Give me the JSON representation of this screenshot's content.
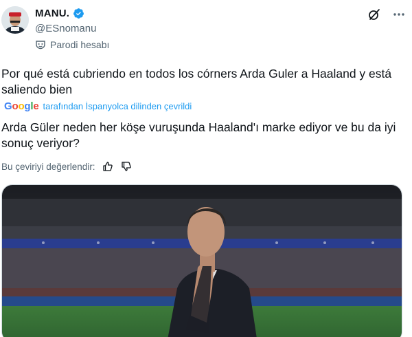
{
  "author": {
    "display_name": "MANU.",
    "handle": "@ESnomanu",
    "label": "Parodi hesabı",
    "verified": true,
    "verified_color": "#1d9bf0"
  },
  "actions": {
    "grok_icon": "grok-icon",
    "more_icon": "more-icon"
  },
  "tweet": {
    "original_text": "Por qué está cubriendo en todos los córners Arda Guler a Haaland y está saliendo bien",
    "translation_provider": "Google",
    "translation_note": "tarafından İspanyolca dilinden çevrildi",
    "translated_text": "Arda Güler neden her köşe vuruşunda Haaland'ı marke ediyor ve bu da iyi sonuç veriyor?"
  },
  "rating": {
    "label": "Bu çeviriyi değerlendir:",
    "up_icon": "thumbs-up-icon",
    "down_icon": "thumbs-down-icon"
  },
  "colors": {
    "text": "#0f1419",
    "secondary": "#536471",
    "link": "#1d9bf0"
  }
}
